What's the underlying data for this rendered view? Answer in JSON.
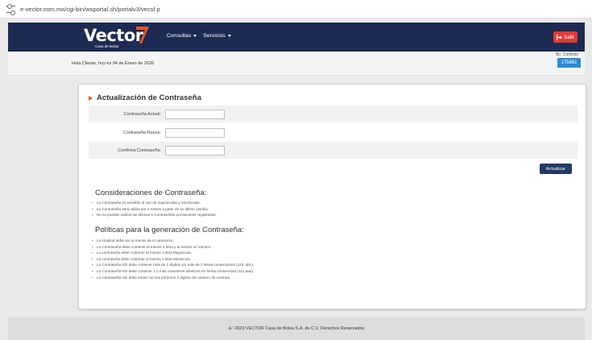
{
  "browser": {
    "url": "e-vector.com.mx/cgi-bin/wsportal.sh/portalv3/vecsf.p"
  },
  "header": {
    "logo_text": "Vector",
    "logo_subtext": "Casa de Bolsa",
    "menu": [
      {
        "label": "Consultas"
      },
      {
        "label": "Servicios"
      }
    ],
    "logout_label": "Salir",
    "colors": {
      "navy": "#1d2a52",
      "logo_accent": "#e8562a",
      "logout": "#e03a3a"
    }
  },
  "greeting": {
    "text": "Hola Cliente, hoy es 04 de Enero de 2026",
    "contract_label": "No. Contrato",
    "contract_number": "175861"
  },
  "form": {
    "title": "Actualización de Contraseña",
    "fields": [
      {
        "label": "Contraseña Actual:",
        "value": ""
      },
      {
        "label": "Contraseña Nueva:",
        "value": ""
      },
      {
        "label": "Confirma Contraseña:",
        "value": ""
      }
    ],
    "submit_label": "Actualizar"
  },
  "considerations": {
    "heading": "Consideraciones de Contraseña:",
    "items": [
      "La Contraseña es sensible al uso de mayúsculas y minúsculas.",
      "La Contraseña será válida por 4 meses a partir de su último cambio.",
      "No se pueden utilizar las últimas 5 Contraseñas previamente registradas."
    ]
  },
  "policies": {
    "heading": "Políticas para la generación de Contraseña:",
    "items": [
      "La longitud debe ser al menos de 6 caracteres.",
      "La Contraseña debe contener al menos 1 letra y al menos un número.",
      "La contraseña debe contener al menos 1 letra Mayúscula.",
      "La contraseña debe contener al menos 1 letra Minúscula.",
      "La Contraseña NO debe contener más de 2 dígitos y/o más de 2 letras consecutivos (123, abc).",
      "La Contraseña NO debe contener 2 o más caracteres idénticos en forma consecutiva (111,aaa).",
      "La Contraseña NO debe iniciar con los primeros 3 dígitos del número de contrato."
    ]
  },
  "footer": {
    "text": "â-' 2023 VECTOR Casa de Bolsa S.A. de C.V. Derechos Reservados"
  }
}
